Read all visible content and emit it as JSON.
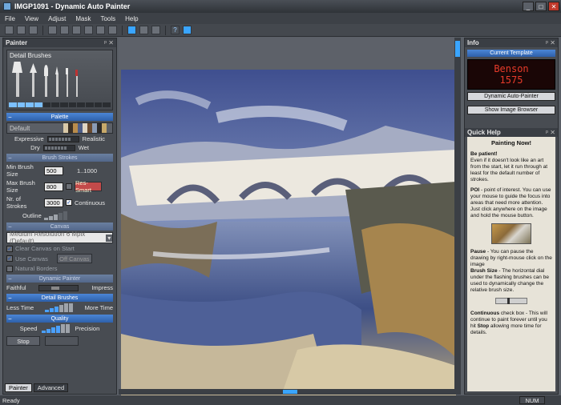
{
  "window": {
    "title": "IMGP1091 - Dynamic Auto Painter",
    "min": "_",
    "max": "□",
    "close": "✕"
  },
  "menu": [
    "File",
    "View",
    "Adjust",
    "Mask",
    "Tools",
    "Help"
  ],
  "painter": {
    "title": "Painter",
    "brush_set": "Detail Brushes",
    "sections": {
      "palette": "Palette",
      "brush_strokes": "Brush Strokes",
      "canvas": "Canvas",
      "dynamic_painter": "Dynamic Painter",
      "detail_brushes": "Detail Brushes",
      "quality": "Quality"
    },
    "palette_name": "Default",
    "palette_colors": [
      "#d9c9a8",
      "#3b3025",
      "#b98c4c",
      "#4e5e88",
      "#e0d6c4",
      "#6a4a2f",
      "#8a9bb5",
      "#2c2a29",
      "#c7a96a",
      "#e9e2d3"
    ],
    "expressive": "Expressive",
    "realistic": "Realistic",
    "dry": "Dry",
    "wet": "Wet",
    "min_brush_label": "Min Brush Size",
    "min_brush_value": "500",
    "range": "1..1000",
    "max_brush_label": "Max Brush Size",
    "max_brush_value": "800",
    "res_smart": "Res-Smart",
    "strokes_label": "Nr. of Strokes",
    "strokes_value": "3000",
    "continuous": "Continuous",
    "outline": "Outline",
    "canvas_option": "Medium Resolution 6 Mpix (Default)",
    "clear_canvas": "Clear Canvas on Start",
    "use_canvas": "Use Canvas",
    "canvas_btn": "Off Canvas",
    "natural_borders": "Natural Borders",
    "faithful": "Faithful",
    "impress": "Impress",
    "less_time": "Less Time",
    "more_time": "More Time",
    "speed": "Speed",
    "precision": "Precision",
    "stop": "Stop",
    "tabs": [
      "Painter",
      "Advanced"
    ]
  },
  "info": {
    "title": "Info",
    "current_template": "Current Template",
    "led_line1": "Benson",
    "led_line2": "1575",
    "btn_app": "Dynamic Auto-Painter",
    "btn_browser": "Show Image Browser"
  },
  "quick_help": {
    "title": "Quick Help",
    "heading": "Painting Now!",
    "p1_bold": "Be patient!",
    "p1": "Even if it doesn't look like an art from the start, let it run through at least for the default number of strokes.",
    "p2_bold": "POI",
    "p2": " - point of interest. You can use your mouse to guide the focus into areas that need more attention. Just click anywhere on the image and hold the mouse button.",
    "p3_bold": "Pause",
    "p3": " - You can pause the drawing by right-mouse click on the image",
    "p3b_bold": "Brush Size",
    "p3b": " - The horizontal dial under the flashing brushes can be used to dynamically change the relative brush size.",
    "p4_bold": "Continuous",
    "p4": " check box - This will continue to paint forever until you hit ",
    "p4b_bold": "Stop",
    "p4b": " allowing more time for details."
  },
  "status": {
    "left": "Ready",
    "num": "NUM"
  }
}
